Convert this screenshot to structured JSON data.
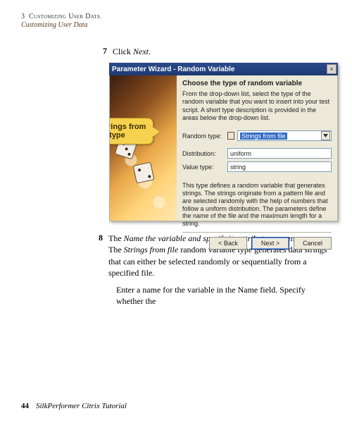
{
  "header": {
    "chapnum": "3",
    "chaptitle": "Customizing User Data",
    "subtitle": "Customizing User Data"
  },
  "step7": {
    "num": "7",
    "lead": "Click ",
    "action": "Next",
    "trail": "."
  },
  "dialog": {
    "windowTitle": "Parameter Wizard - Random Variable",
    "closeGlyph": "×",
    "heading": "Choose the type of random variable",
    "intro": "From the drop-down list, select the type of the random variable that you want to insert into your test script. A short type description is provided in the areas below the drop-down list.",
    "labels": {
      "randomType": "Random type:",
      "distribution": "Distribution:",
      "valueType": "Value type:"
    },
    "values": {
      "randomType": "Strings from file",
      "distribution": "uniform",
      "valueType": "string"
    },
    "description": "This type defines a random variable that generates strings. The strings originate from a pattern file and are selected randomly with the help of numbers that follow a uniform distribution. The parameters define the name of the file and the maximum length for a string.",
    "buttons": {
      "back": "< Back",
      "next": "Next >",
      "cancel": "Cancel"
    }
  },
  "callout": {
    "line1": "Select Strings from",
    "line2": "file type"
  },
  "step8": {
    "num": "8",
    "text_pre": "The ",
    "it1": "Name the variable and specify its attributes",
    "text_mid1": " screen appears. The ",
    "it2": "Strings from file",
    "text_mid2": " random variable type generates data strings that can either be selected randomly or sequentially from a specified file."
  },
  "para2": {
    "pre": "Enter a name for the variable in the ",
    "it": "Name",
    "post": " field. Specify whether the"
  },
  "footer": {
    "page": "44",
    "title": "SilkPerformer Citrix Tutorial"
  },
  "icons": {
    "dropdown_name": "dropdown-icon"
  }
}
